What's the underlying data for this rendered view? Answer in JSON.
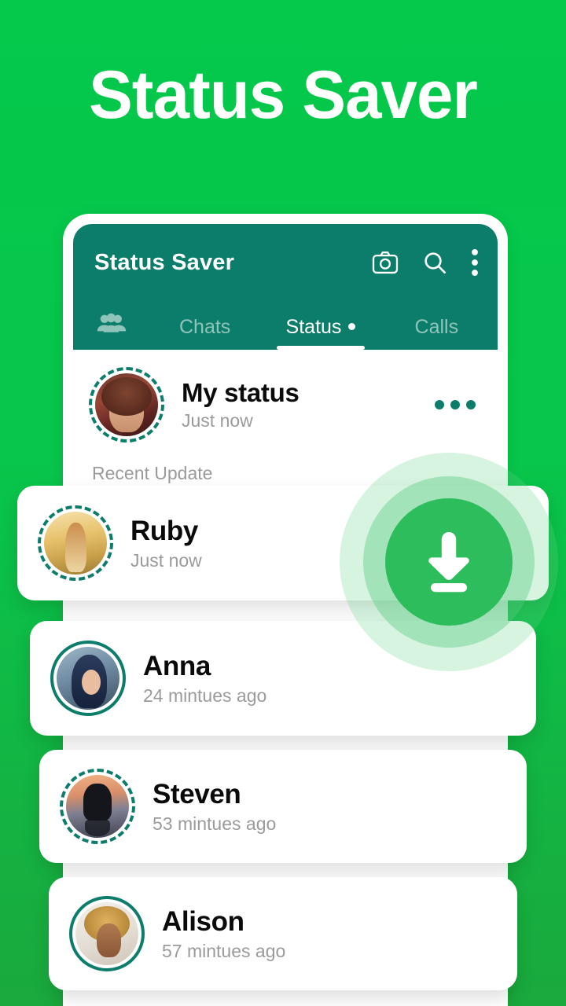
{
  "hero": {
    "title": "Status Saver"
  },
  "colors": {
    "background_top": "#04C94B",
    "background_bottom": "#1AA93D",
    "appbar": "#0D7D6B",
    "accent_teal": "#0D7D6B",
    "fab_green": "#2EBD5C",
    "card": "#FFFFFF"
  },
  "app": {
    "appbar": {
      "title": "Status Saver",
      "icons": [
        {
          "name": "camera-icon",
          "label": "Camera"
        },
        {
          "name": "search-icon",
          "label": "Search"
        },
        {
          "name": "overflow-menu-icon",
          "label": "More options"
        }
      ]
    },
    "tabs": [
      {
        "name": "groups",
        "label": "",
        "icon": "groups-icon",
        "active": false
      },
      {
        "name": "chats",
        "label": "Chats",
        "active": false
      },
      {
        "name": "status",
        "label": "Status",
        "active": true,
        "badge_dot": true
      },
      {
        "name": "calls",
        "label": "Calls",
        "active": false
      }
    ],
    "my_status": {
      "name": "My status",
      "time": "Just now",
      "menu": "more-options",
      "ring_style": "dashed"
    },
    "section_label": "Recent Update",
    "statuses": [
      {
        "name": "Ruby",
        "time": "Just now",
        "ring_style": "dashed",
        "avatar": "ph-ruby"
      },
      {
        "name": "Anna",
        "time": "24 mintues ago",
        "ring_style": "solid",
        "avatar": "ph-anna"
      },
      {
        "name": "Steven",
        "time": "53 mintues ago",
        "ring_style": "dashed",
        "avatar": "ph-steven"
      },
      {
        "name": "Alison",
        "time": "57 mintues ago",
        "ring_style": "solid",
        "avatar": "ph-alison"
      }
    ],
    "download_button": {
      "name": "download-button",
      "label": "Download"
    }
  }
}
